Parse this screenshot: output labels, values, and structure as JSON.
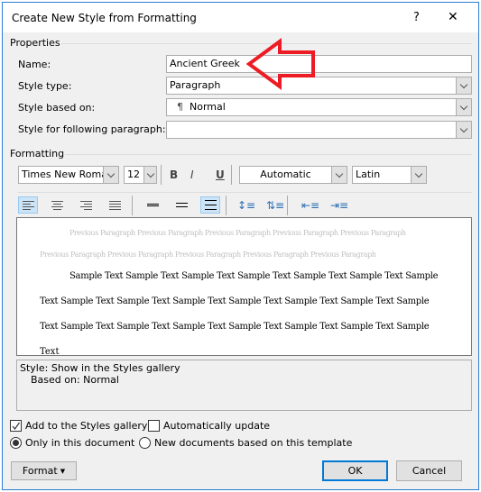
{
  "window": {
    "title": "Create New Style from Formatting",
    "help_label": "?",
    "close_label": "✕"
  },
  "properties": {
    "section_label": "Properties",
    "name": {
      "label": "Name:",
      "value": "Ancient Greek"
    },
    "style_type": {
      "label": "Style type:",
      "value": "Paragraph"
    },
    "style_based_on": {
      "label": "Style based on:",
      "value": "Normal",
      "icon": "¶"
    },
    "style_following": {
      "label": "Style for following paragraph:",
      "value": ""
    }
  },
  "formatting": {
    "section_label": "Formatting",
    "font": "Times New Roman",
    "size": "12",
    "bold": "B",
    "italic": "I",
    "underline": "U",
    "color": "Automatic",
    "script": "Latin"
  },
  "preview": {
    "previous_line1": "Previous Paragraph Previous Paragraph Previous Paragraph Previous Paragraph Previous Paragraph",
    "previous_line2": "Previous Paragraph Previous Paragraph Previous Paragraph Previous Paragraph Previous Paragraph",
    "sample_line1": "Sample Text Sample Text Sample Text Sample Text Sample Text Sample Text Sample",
    "sample_line2": "Text Sample Text Sample Text Sample Text Sample Text Sample Text Sample Text Sample",
    "sample_line3": "Text Sample Text Sample Text Sample Text Sample Text Sample Text Sample Text Sample",
    "sample_line4": "Text"
  },
  "description": {
    "line1": "Style: Show in the Styles gallery",
    "line2": "Based on: Normal"
  },
  "options": {
    "add_to_gallery": {
      "label": "Add to the Styles gallery",
      "checked": true
    },
    "auto_update": {
      "label": "Automatically update",
      "checked": false
    },
    "only_this_doc": {
      "label": "Only in this document",
      "selected": true
    },
    "new_docs": {
      "label": "New documents based on this template",
      "selected": false
    }
  },
  "buttons": {
    "format": "Format",
    "ok": "OK",
    "cancel": "Cancel"
  },
  "colors": {
    "accent": "#0078d7",
    "annotation_arrow": "#ed1c24",
    "selected_tool": "#cce4f7"
  }
}
